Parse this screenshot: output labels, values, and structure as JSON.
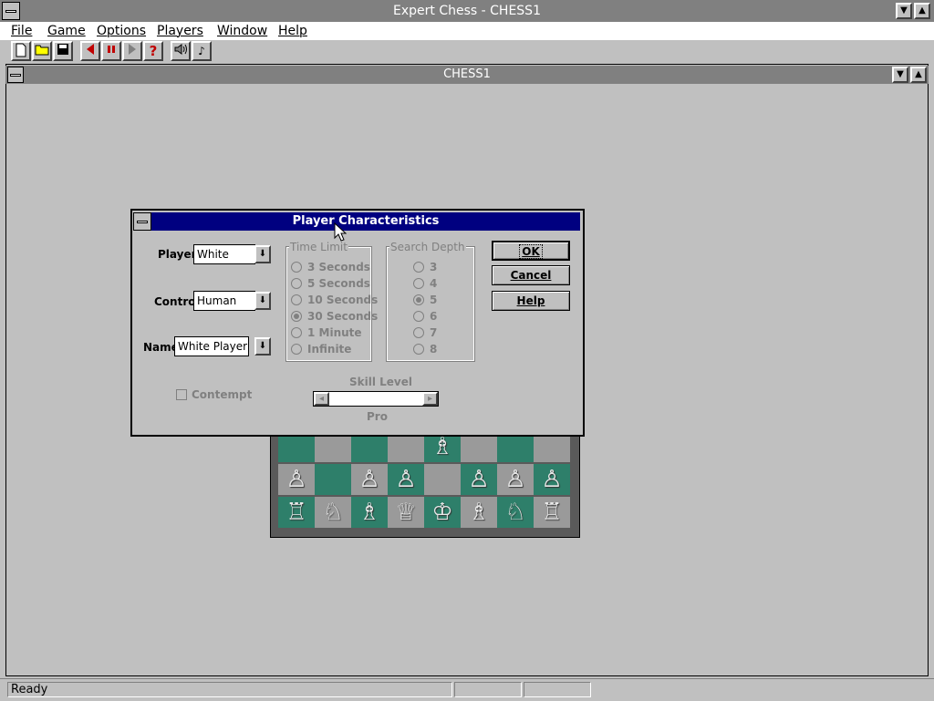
{
  "app": {
    "title": "Expert Chess - CHESS1",
    "child_title": "CHESS1"
  },
  "menu": [
    "File",
    "Game",
    "Options",
    "Players",
    "Window",
    "Help"
  ],
  "toolbar_icons": [
    "new-document-icon",
    "open-folder-icon",
    "save-icon",
    "back-arrow-icon",
    "pause-icon",
    "forward-arrow-icon",
    "help-question-icon",
    "sound-icon",
    "music-note-icon"
  ],
  "status": {
    "text": "Ready"
  },
  "dialog": {
    "title": "Player Characteristics",
    "player_label": "Player",
    "player_value": "White",
    "control_label": "Control",
    "control_value": "Human",
    "name_label": "Name",
    "name_value": "White Player",
    "time_limit": {
      "label": "Time Limit",
      "options": [
        "3 Seconds",
        "5 Seconds",
        "10 Seconds",
        "30 Seconds",
        "1 Minute",
        "Infinite"
      ],
      "selected": "30 Seconds"
    },
    "search_depth": {
      "label": "Search Depth",
      "options": [
        "3",
        "4",
        "5",
        "6",
        "7",
        "8"
      ],
      "selected": "5"
    },
    "ok": "OK",
    "cancel": "Cancel",
    "help": "Help",
    "contempt": "Contempt",
    "skill_label": "Skill Level",
    "skill_value": "Pro"
  },
  "colors": {
    "dialog_title_bg": "#000080",
    "inactive_title": "#808080",
    "board_dark": "#2e7f6a",
    "board_light": "#9a9a9a"
  }
}
